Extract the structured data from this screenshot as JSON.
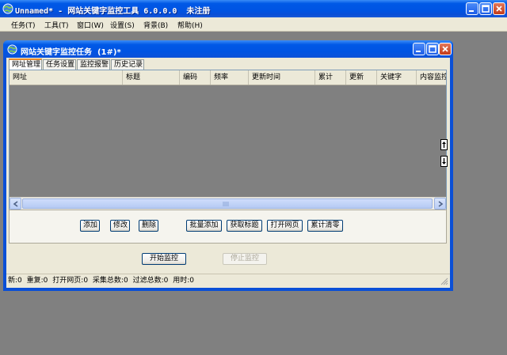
{
  "app": {
    "title": "Unnamed* - 网站关键字监控工具 6.0.0.0  未注册"
  },
  "menubar": {
    "items": [
      "任务(T)",
      "工具(T)",
      "窗口(W)",
      "设置(S)",
      "背景(B)",
      "帮助(H)"
    ]
  },
  "child": {
    "title": "网站关键字监控任务  (1#)*",
    "tabs": [
      "网址管理",
      "任务设置",
      "监控报警",
      "历史记录"
    ],
    "active_tab": 0,
    "columns": [
      "网址",
      "标题",
      "编码",
      "频率",
      "更新时间",
      "累计",
      "更新",
      "关键字",
      "内容监控"
    ],
    "buttons": [
      "添加",
      "修改",
      "删除",
      "批量添加",
      "获取标题",
      "打开网页",
      "累计清零"
    ],
    "start_label": "开始监控",
    "stop_label": "停止监控",
    "status": [
      "新:0",
      "重复:0",
      "打开网页:0",
      "采集总数:0",
      "过滤总数:0",
      "用时:0"
    ]
  },
  "colors": {
    "title_blue": "#0054e3",
    "window_face": "#ece9d8",
    "mdi_gray": "#808080"
  }
}
